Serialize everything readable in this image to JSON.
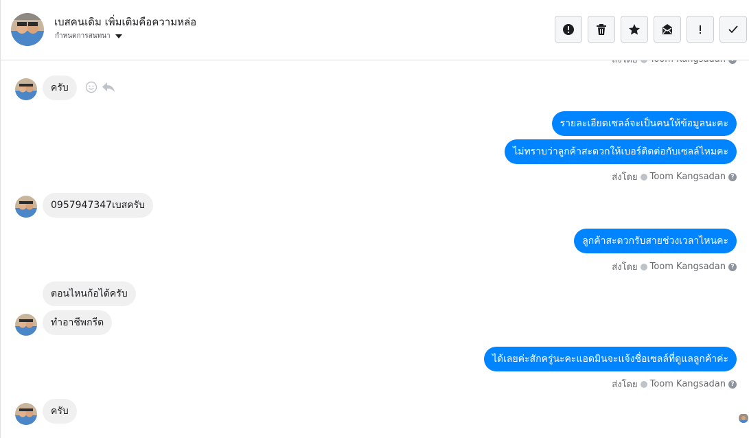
{
  "header": {
    "title": "เบสคนเดิม เพิ่มเติมคือความหล่อ",
    "subtitle": "กำหนดการสนทนา"
  },
  "toolbar": {
    "buttons": [
      {
        "icon": "alert-circle-icon"
      },
      {
        "icon": "trash-icon"
      },
      {
        "icon": "star-icon"
      },
      {
        "icon": "mail-mark-unread-icon"
      },
      {
        "icon": "exclamation-icon"
      },
      {
        "icon": "checkmark-icon"
      }
    ]
  },
  "messages": {
    "m1": "ครับ",
    "m2": "รายละเอียดเซลล์จะเป็นคนให้ข้อมูลนะคะ",
    "m3": "ไม่ทราบว่าลูกค้าสะดวกให้เบอร์ติดต่อกับเซลล์ไหมคะ",
    "m4": "0957947347เบสครับ",
    "m5": "ลูกค้าสะดวกรับสายช่วงเวลาไหนคะ",
    "m6": "ตอนไหนก้อได้ครับ",
    "m7": "ทำอาชีพกรีด",
    "m8": "ได้เลยค่ะสักครู่นะคะแอดมินจะแจ้งชื่อเซลล์ที่ดูแลลูกค้าค่ะ",
    "m9": "ครับ"
  },
  "sent_by": {
    "label": "ส่งโดย",
    "name": "Toom Kangsadan"
  },
  "colors": {
    "outgoing": "#0084ff",
    "incoming": "#f1f0f0"
  }
}
